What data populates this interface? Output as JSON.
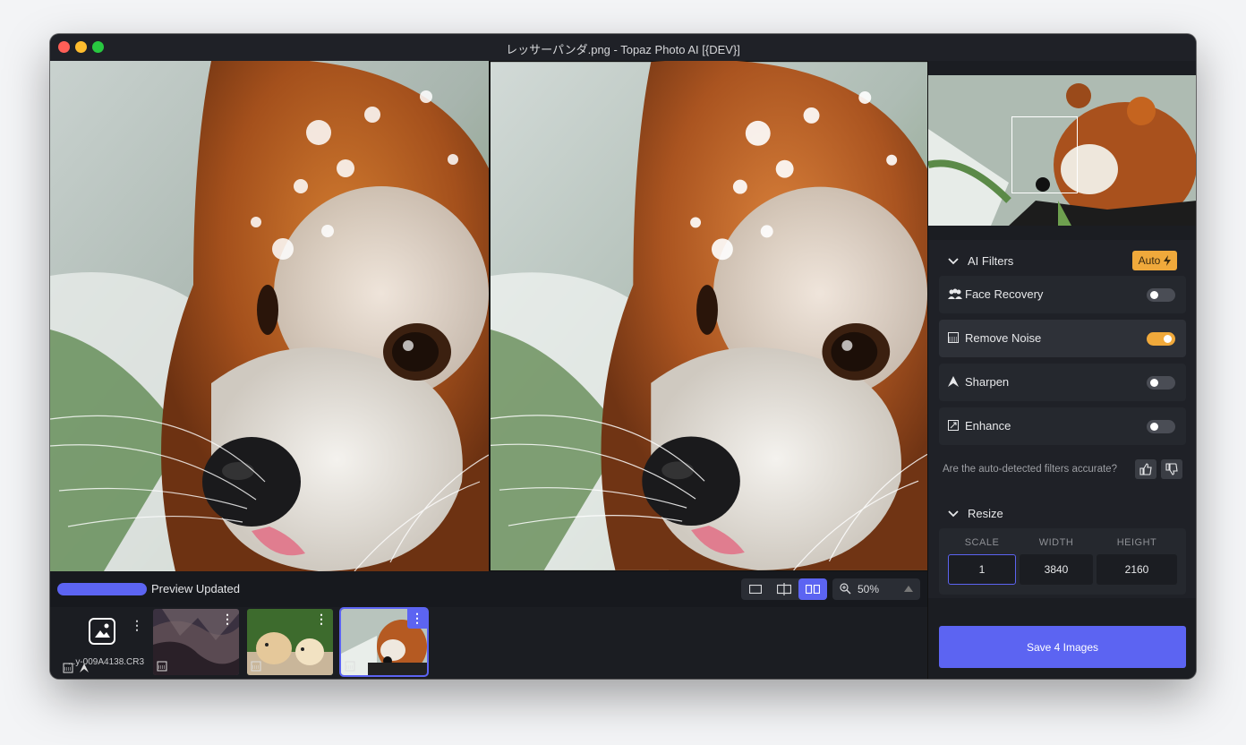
{
  "window": {
    "title": "レッサーパンダ.png - Topaz Photo AI [{DEV}]"
  },
  "viewer": {
    "status_label": "Preview Updated",
    "zoom": "50%",
    "view_mode_selected": "side-by-side"
  },
  "filmstrip": {
    "file_name": "...y-009A4138.CR3",
    "thumbnails": [
      {
        "name": "canyon-thumbnail",
        "selected": false
      },
      {
        "name": "puppies-thumbnail",
        "selected": false
      },
      {
        "name": "red-panda-thumbnail",
        "selected": true
      }
    ]
  },
  "sidebar": {
    "ai_filters": {
      "title": "AI Filters",
      "auto_label": "Auto",
      "filters": [
        {
          "label": "Face Recovery",
          "enabled": false,
          "icon": "people-icon"
        },
        {
          "label": "Remove Noise",
          "enabled": true,
          "icon": "noise-icon"
        },
        {
          "label": "Sharpen",
          "enabled": false,
          "icon": "sharpen-icon"
        },
        {
          "label": "Enhance",
          "enabled": false,
          "icon": "enhance-icon"
        }
      ],
      "feedback_question": "Are the auto-detected filters accurate?"
    },
    "resize": {
      "title": "Resize",
      "scale_label": "SCALE",
      "width_label": "WIDTH",
      "height_label": "HEIGHT",
      "scale": "1",
      "width": "3840",
      "height": "2160"
    },
    "save_label": "Save 4 Images"
  },
  "colors": {
    "accent": "#5c64f2",
    "toggle_on": "#f0a93b",
    "background": "#1b1d22"
  }
}
